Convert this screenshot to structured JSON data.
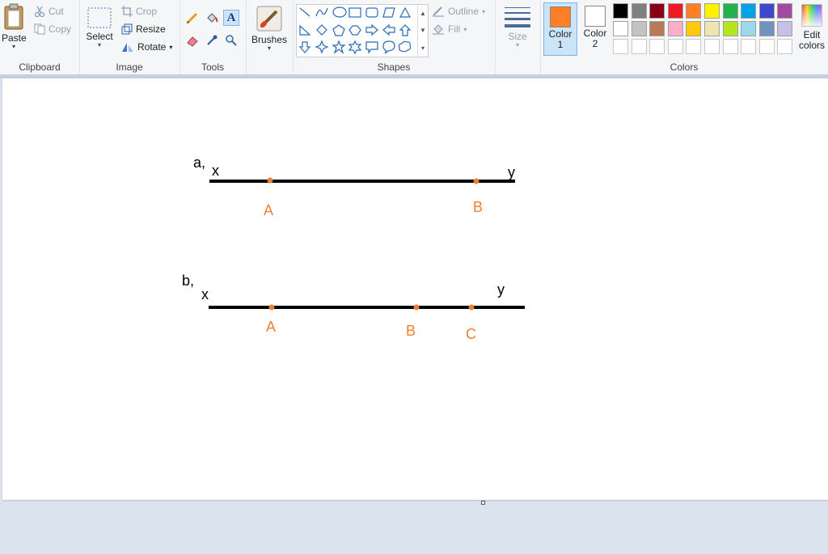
{
  "clipboard": {
    "paste_label": "Paste",
    "cut_label": "Cut",
    "copy_label": "Copy",
    "group_label": "Clipboard"
  },
  "image": {
    "select_label": "Select",
    "crop_label": "Crop",
    "resize_label": "Resize",
    "rotate_label": "Rotate",
    "group_label": "Image"
  },
  "tools": {
    "group_label": "Tools"
  },
  "brushes": {
    "label": "Brushes"
  },
  "shapes": {
    "group_label": "Shapes",
    "outline_label": "Outline",
    "fill_label": "Fill"
  },
  "size": {
    "label": "Size"
  },
  "colors": {
    "group_label": "Colors",
    "color1_label": "Color",
    "color1_num": "1",
    "color2_label": "Color",
    "color2_num": "2",
    "color1_value": "#ff7f27",
    "color2_value": "#ffffff",
    "edit_label_1": "Edit",
    "edit_label_2": "colors",
    "palette_row1": [
      "#000000",
      "#7f7f7f",
      "#880015",
      "#ed1c24",
      "#ff7f27",
      "#fff200",
      "#22b14c",
      "#00a2e8",
      "#3f48cc",
      "#a349a4"
    ],
    "palette_row2": [
      "#ffffff",
      "#c3c3c3",
      "#b97a57",
      "#ffaec9",
      "#ffc90e",
      "#efe4b0",
      "#b5e61d",
      "#99d9ea",
      "#7092be",
      "#c8bfe7"
    ]
  },
  "drawing": {
    "a": {
      "label": "a,",
      "x_label": "x",
      "y_label": "y",
      "points": [
        "A",
        "B"
      ]
    },
    "b": {
      "label": "b,",
      "x_label": "x",
      "y_label": "y",
      "points": [
        "A",
        "B",
        "C"
      ]
    },
    "point_color": "#f08030",
    "line_color": "#000000"
  }
}
